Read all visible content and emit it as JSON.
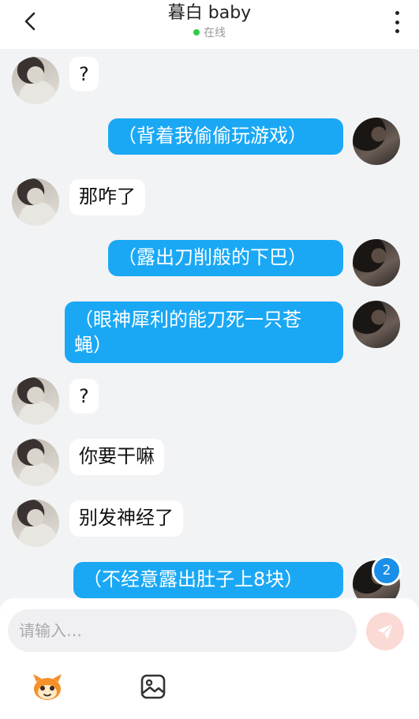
{
  "header": {
    "title": "暮白 baby",
    "status": "在线"
  },
  "messages": [
    {
      "side": "other",
      "text": "?"
    },
    {
      "side": "self",
      "text": "（背着我偷偷玩游戏）"
    },
    {
      "side": "other",
      "text": "那咋了"
    },
    {
      "side": "self",
      "text": "（露出刀削般的下巴）"
    },
    {
      "side": "self",
      "text": "（眼神犀利的能刀死一只苍\n蝇）"
    },
    {
      "side": "other",
      "text": "?"
    },
    {
      "side": "other",
      "text": "你要干嘛"
    },
    {
      "side": "other",
      "text": "别发神经了"
    },
    {
      "side": "self",
      "text": "（不经意露出肚子上8块）"
    }
  ],
  "unread_count": "2",
  "composer": {
    "placeholder": "请输入…",
    "value": ""
  },
  "icons": {
    "back": "back-arrow-icon",
    "more": "more-vertical-icon",
    "send": "send-plane-icon",
    "emoji": "mascot-emoji-icon",
    "image": "image-icon"
  },
  "colors": {
    "self_bubble": "#1aa8f5",
    "other_bubble": "#ffffff",
    "online_dot": "#2ecc40",
    "badge": "#1a8fe8",
    "send_button": "#fbd9d5"
  }
}
